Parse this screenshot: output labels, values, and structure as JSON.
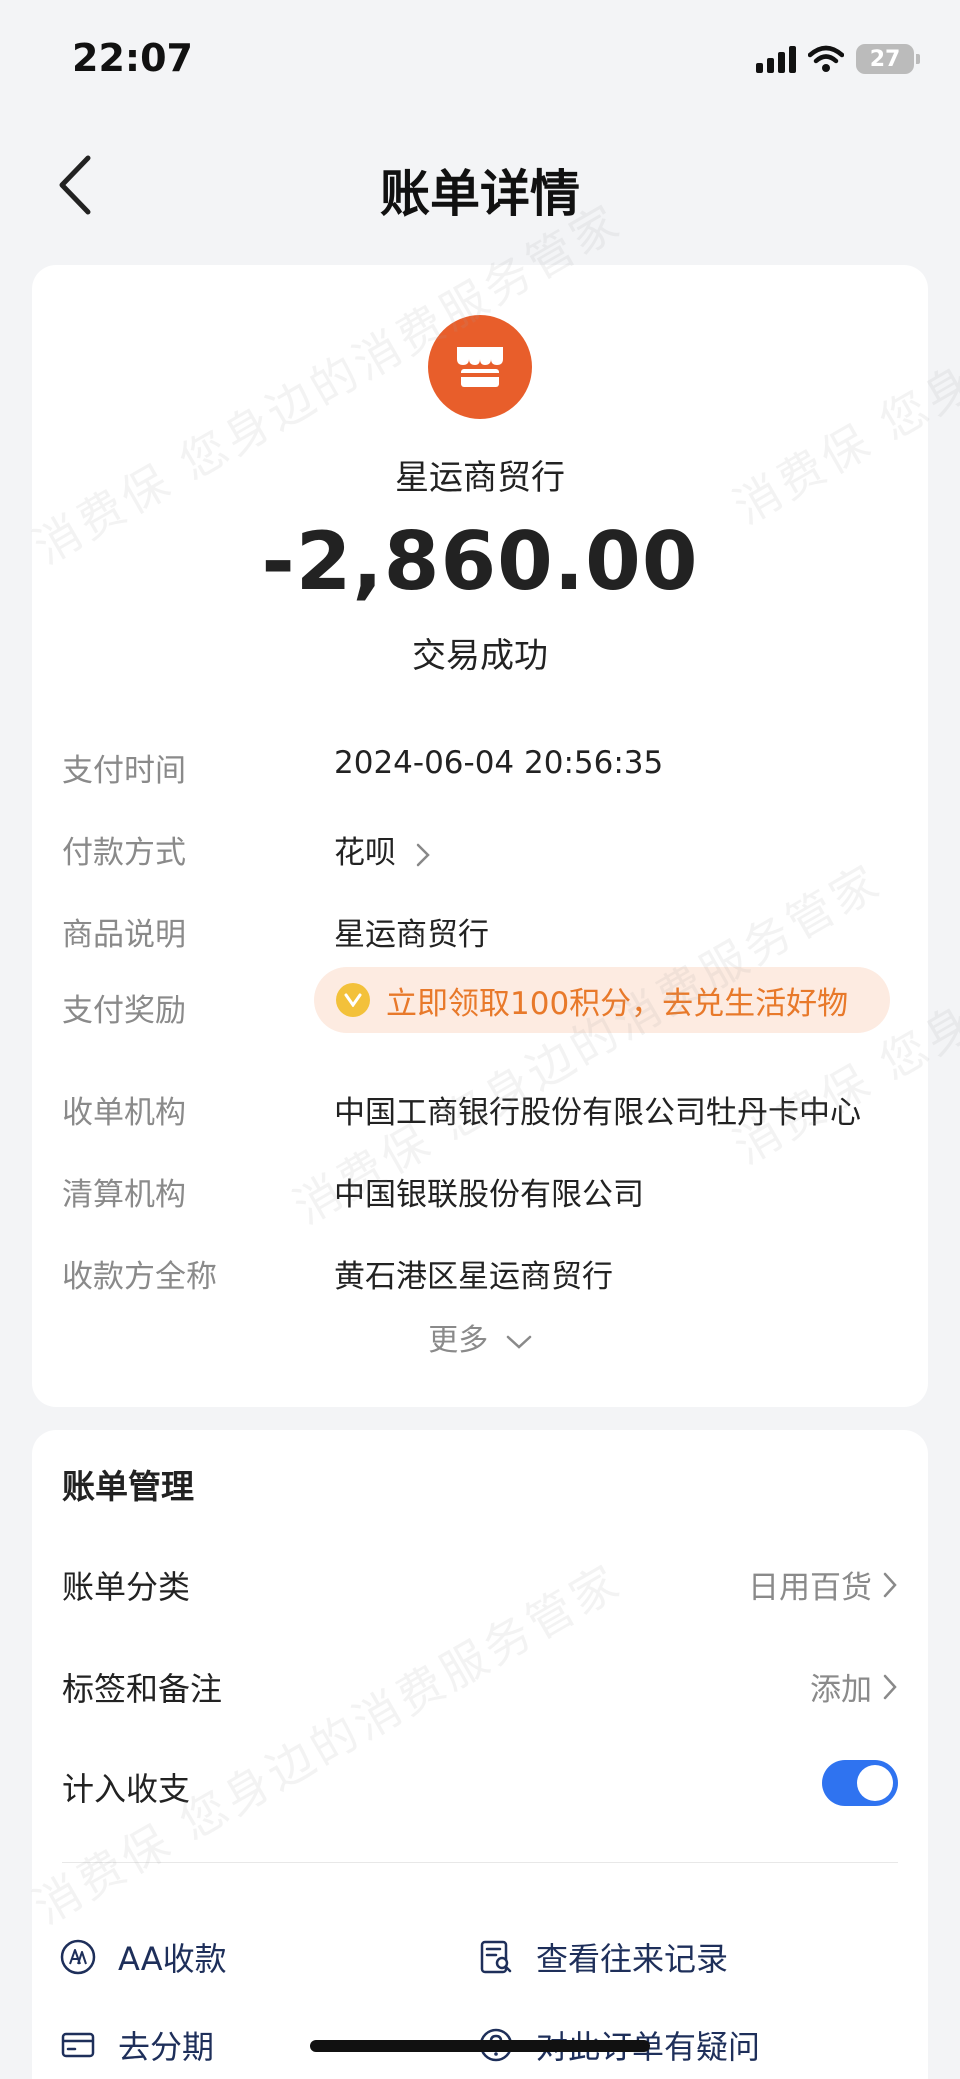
{
  "status_bar": {
    "time": "22:07",
    "battery": "27"
  },
  "nav": {
    "title": "账单详情"
  },
  "summary": {
    "merchant": "星运商贸行",
    "amount": "-2,860.00",
    "status": "交易成功"
  },
  "details": [
    {
      "label": "支付时间",
      "value": "2024-06-04 20:56:35"
    },
    {
      "label": "付款方式",
      "value": "花呗"
    },
    {
      "label": "商品说明",
      "value": "星运商贸行"
    },
    {
      "label": "支付奖励",
      "value": "立即领取100积分，去兑生活好物"
    },
    {
      "label": "收单机构",
      "value": "中国工商银行股份有限公司牡丹卡中心"
    },
    {
      "label": "清算机构",
      "value": "中国银联股份有限公司"
    },
    {
      "label": "收款方全称",
      "value": "黄石港区星运商贸行"
    }
  ],
  "more_label": "更多",
  "management": {
    "title": "账单管理",
    "category_label": "账单分类",
    "category_value": "日用百货",
    "tags_label": "标签和备注",
    "tags_value": "添加",
    "include_label": "计入收支",
    "include_on": true
  },
  "actions": {
    "aa": "AA收款",
    "history": "查看往来记录",
    "installment": "去分期",
    "question": "对此订单有疑问"
  },
  "watermark": "消费保 您身边的消费服务管家",
  "colors": {
    "merchant_icon": "#e85e2b",
    "toggle": "#2f73f0",
    "reward_text": "#e8792a",
    "reward_bg": "#fdebe1"
  }
}
